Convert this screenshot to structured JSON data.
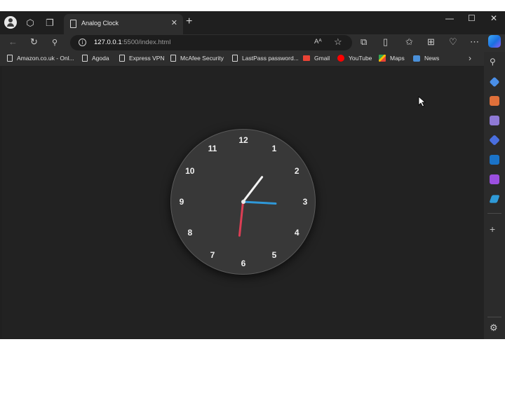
{
  "browser": {
    "tab_title": "Analog Clock",
    "tab_close": "✕",
    "new_tab": "+",
    "window_controls": {
      "minimize": "—",
      "maximize": "☐",
      "close": "✕"
    }
  },
  "address_bar": {
    "host": "127.0.0.1",
    "path": ":5500/index.html",
    "read_aloud": "Aᴬ"
  },
  "bookmarks": [
    {
      "label": "Amazon.co.uk - Onl...",
      "icon": "page-icon"
    },
    {
      "label": "Agoda",
      "icon": "page-icon"
    },
    {
      "label": "Express VPN",
      "icon": "page-icon"
    },
    {
      "label": "McAfee Security",
      "icon": "page-icon"
    },
    {
      "label": "LastPass password...",
      "icon": "page-icon"
    },
    {
      "label": "Gmail",
      "icon": "gmail-icon"
    },
    {
      "label": "YouTube",
      "icon": "youtube-icon"
    },
    {
      "label": "Maps",
      "icon": "maps-icon"
    },
    {
      "label": "News",
      "icon": "news-icon"
    }
  ],
  "clock": {
    "numerals": [
      "12",
      "1",
      "2",
      "3",
      "4",
      "5",
      "6",
      "7",
      "8",
      "9",
      "10",
      "11"
    ],
    "time": {
      "hour": 1,
      "minute": 15,
      "second": 31
    },
    "colors": {
      "hour_hand": "#f4f4f4",
      "minute_hand": "#2f98d8",
      "second_hand": "#dc3e54",
      "face": "#383838"
    }
  },
  "sidebar_icons": [
    "search-icon",
    "tag-icon",
    "briefcase-icon",
    "games-icon",
    "copilot-icon",
    "outlook-icon",
    "designer-icon",
    "send-icon",
    "add-icon",
    "settings-icon"
  ]
}
